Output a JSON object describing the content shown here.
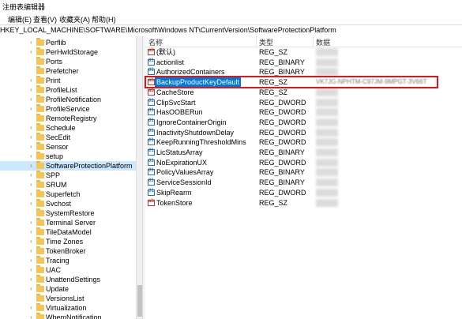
{
  "window": {
    "title": "注册表编辑器"
  },
  "menu": [
    "编辑(E)",
    "查看(V)",
    "收藏夹(A)",
    "帮助(H)"
  ],
  "address": "HKEY_LOCAL_MACHINE\\SOFTWARE\\Microsoft\\Windows NT\\CurrentVersion\\SoftwareProtectionPlatform",
  "tree": {
    "items": [
      {
        "label": "Perflib",
        "expandable": true
      },
      {
        "label": "PerHwIdStorage",
        "expandable": true
      },
      {
        "label": "Ports",
        "expandable": false
      },
      {
        "label": "Prefetcher",
        "expandable": false
      },
      {
        "label": "Print",
        "expandable": true
      },
      {
        "label": "ProfileList",
        "expandable": true
      },
      {
        "label": "ProfileNotification",
        "expandable": true
      },
      {
        "label": "ProfileService",
        "expandable": true
      },
      {
        "label": "RemoteRegistry",
        "expandable": false
      },
      {
        "label": "Schedule",
        "expandable": true
      },
      {
        "label": "SecEdit",
        "expandable": true
      },
      {
        "label": "Sensor",
        "expandable": true
      },
      {
        "label": "setup",
        "expandable": true
      },
      {
        "label": "SoftwareProtectionPlatform",
        "expandable": true,
        "selected": true
      },
      {
        "label": "SPP",
        "expandable": true
      },
      {
        "label": "SRUM",
        "expandable": true
      },
      {
        "label": "Superfetch",
        "expandable": true
      },
      {
        "label": "Svchost",
        "expandable": true
      },
      {
        "label": "SystemRestore",
        "expandable": false
      },
      {
        "label": "Terminal Server",
        "expandable": true
      },
      {
        "label": "TileDataModel",
        "expandable": true
      },
      {
        "label": "Time Zones",
        "expandable": true
      },
      {
        "label": "TokenBroker",
        "expandable": true
      },
      {
        "label": "Tracing",
        "expandable": true
      },
      {
        "label": "UAC",
        "expandable": true
      },
      {
        "label": "UnattendSettings",
        "expandable": true
      },
      {
        "label": "Update",
        "expandable": true
      },
      {
        "label": "VersionsList",
        "expandable": false
      },
      {
        "label": "Virtualization",
        "expandable": true
      },
      {
        "label": "WbemNotification",
        "expandable": true
      }
    ]
  },
  "list": {
    "headers": {
      "name": "名称",
      "type": "类型",
      "data": "数据"
    },
    "rows": [
      {
        "name": "(默认)",
        "type": "REG_SZ",
        "icon": "sz"
      },
      {
        "name": "actionlist",
        "type": "REG_BINARY",
        "icon": "num"
      },
      {
        "name": "AuthorizedContainers",
        "type": "REG_BINARY",
        "icon": "num"
      },
      {
        "name": "BackupProductKeyDefault",
        "type": "REG_SZ",
        "icon": "sz",
        "selected": true,
        "data": "VK7JG-NPHTM-C97JM-9MPGT-3V66T"
      },
      {
        "name": "CacheStore",
        "type": "REG_SZ",
        "icon": "sz"
      },
      {
        "name": "ClipSvcStart",
        "type": "REG_DWORD",
        "icon": "num"
      },
      {
        "name": "HasOOBERun",
        "type": "REG_DWORD",
        "icon": "num"
      },
      {
        "name": "IgnoreContainerOrigin",
        "type": "REG_DWORD",
        "icon": "num"
      },
      {
        "name": "InactivityShutdownDelay",
        "type": "REG_DWORD",
        "icon": "num"
      },
      {
        "name": "KeepRunningThresholdMins",
        "type": "REG_DWORD",
        "icon": "num"
      },
      {
        "name": "LicStatusArray",
        "type": "REG_BINARY",
        "icon": "num"
      },
      {
        "name": "NoExpirationUX",
        "type": "REG_DWORD",
        "icon": "num"
      },
      {
        "name": "PolicyValuesArray",
        "type": "REG_BINARY",
        "icon": "num"
      },
      {
        "name": "ServiceSessionId",
        "type": "REG_BINARY",
        "icon": "num"
      },
      {
        "name": "SkipRearm",
        "type": "REG_DWORD",
        "icon": "num"
      },
      {
        "name": "TokenStore",
        "type": "REG_SZ",
        "icon": "sz"
      }
    ]
  }
}
